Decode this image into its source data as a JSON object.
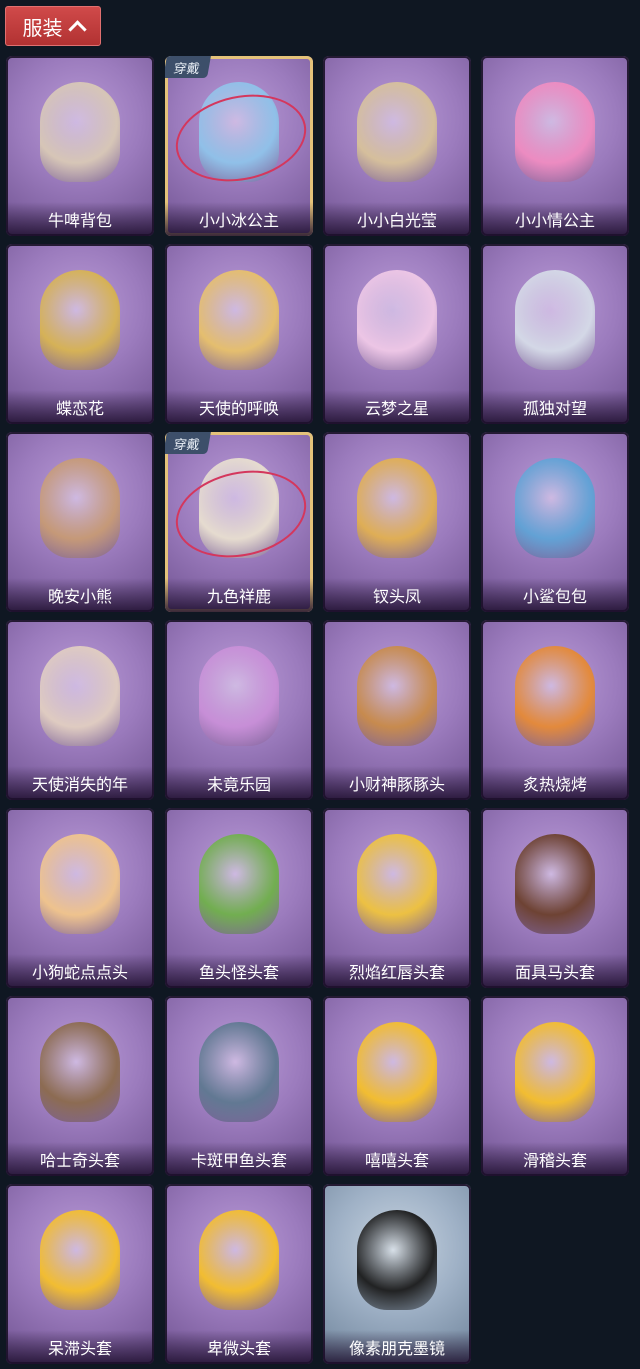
{
  "header": {
    "title": "服装",
    "icon": "chevron-up-icon"
  },
  "badge_label": "穿戴",
  "items": [
    {
      "name": "牛啤背包",
      "color": "#d9c9b6",
      "worn": false,
      "theme": "purple"
    },
    {
      "name": "小小冰公主",
      "color": "#8fc3ea",
      "worn": true,
      "theme": "purple"
    },
    {
      "name": "小小白光莹",
      "color": "#d8c29a",
      "worn": false,
      "theme": "purple"
    },
    {
      "name": "小小情公主",
      "color": "#f08cc1",
      "worn": false,
      "theme": "purple"
    },
    {
      "name": "蝶恋花",
      "color": "#d8b451",
      "worn": false,
      "theme": "purple"
    },
    {
      "name": "天使的呼唤",
      "color": "#e8c16a",
      "worn": false,
      "theme": "purple"
    },
    {
      "name": "云梦之星",
      "color": "#f0c9e7",
      "worn": false,
      "theme": "purple"
    },
    {
      "name": "孤独对望",
      "color": "#d6dce8",
      "worn": false,
      "theme": "purple"
    },
    {
      "name": "晚安小熊",
      "color": "#c79a74",
      "worn": false,
      "theme": "purple"
    },
    {
      "name": "九色祥鹿",
      "color": "#e9e0d0",
      "worn": true,
      "theme": "purple"
    },
    {
      "name": "钗头凤",
      "color": "#e2b050",
      "worn": false,
      "theme": "purple"
    },
    {
      "name": "小鲨包包",
      "color": "#5fa3d6",
      "worn": false,
      "theme": "purple"
    },
    {
      "name": "天使消失的年",
      "color": "#e2cfc1",
      "worn": false,
      "theme": "purple"
    },
    {
      "name": "未竟乐园",
      "color": "#c98fd8",
      "worn": false,
      "theme": "purple"
    },
    {
      "name": "小财神豚豚头",
      "color": "#c98b48",
      "worn": false,
      "theme": "purple"
    },
    {
      "name": "炙热烧烤",
      "color": "#e68a35",
      "worn": false,
      "theme": "purple"
    },
    {
      "name": "小狗蛇点点头",
      "color": "#f2c68b",
      "worn": false,
      "theme": "purple"
    },
    {
      "name": "鱼头怪头套",
      "color": "#6fb04a",
      "worn": false,
      "theme": "purple"
    },
    {
      "name": "烈焰红唇头套",
      "color": "#f0c43c",
      "worn": false,
      "theme": "purple"
    },
    {
      "name": "面具马头套",
      "color": "#6b3f2c",
      "worn": false,
      "theme": "purple"
    },
    {
      "name": "哈士奇头套",
      "color": "#8b6a4c",
      "worn": false,
      "theme": "purple"
    },
    {
      "name": "卡斑甲鱼头套",
      "color": "#5e7890",
      "worn": false,
      "theme": "purple"
    },
    {
      "name": "嘻嘻头套",
      "color": "#f6c02a",
      "worn": false,
      "theme": "purple"
    },
    {
      "name": "滑稽头套",
      "color": "#f6c02a",
      "worn": false,
      "theme": "purple"
    },
    {
      "name": "呆滞头套",
      "color": "#f6c02a",
      "worn": false,
      "theme": "purple"
    },
    {
      "name": "卑微头套",
      "color": "#f6c02a",
      "worn": false,
      "theme": "purple"
    },
    {
      "name": "像素朋克墨镜",
      "color": "#1a1a1a",
      "worn": false,
      "theme": "blue"
    }
  ]
}
